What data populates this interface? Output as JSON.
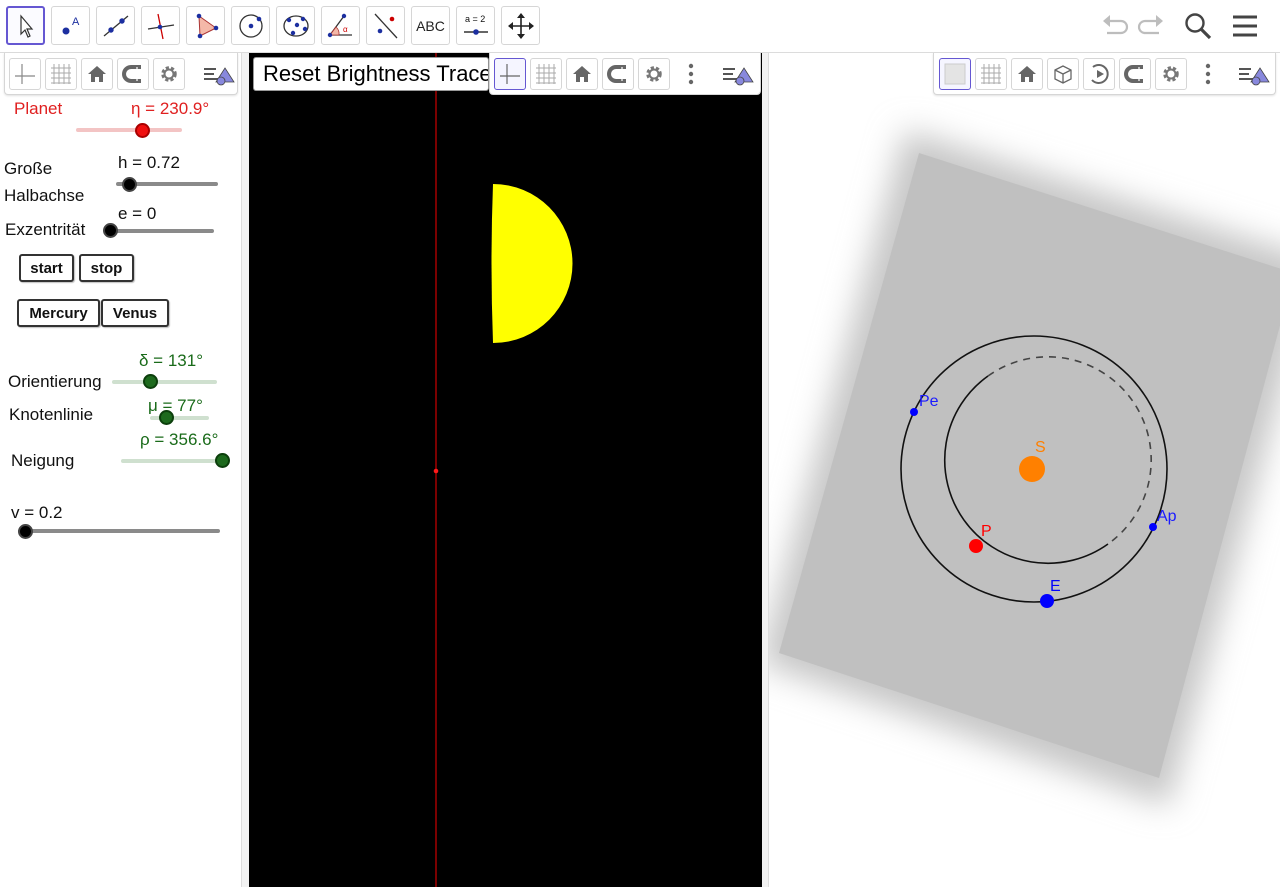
{
  "toolbar": {
    "tools": [
      {
        "name": "move-tool",
        "label": ""
      },
      {
        "name": "point-tool",
        "label": "A"
      },
      {
        "name": "line-tool",
        "label": ""
      },
      {
        "name": "perpendicular-line-tool",
        "label": ""
      },
      {
        "name": "polygon-tool",
        "label": ""
      },
      {
        "name": "circle-center-point-tool",
        "label": ""
      },
      {
        "name": "conic-five-points-tool",
        "label": ""
      },
      {
        "name": "angle-tool",
        "label": "α"
      },
      {
        "name": "reflect-tool",
        "label": ""
      },
      {
        "name": "text-tool",
        "label": "ABC"
      },
      {
        "name": "slider-tool",
        "label": "a = 2"
      },
      {
        "name": "move-graphics-view-tool",
        "label": ""
      }
    ]
  },
  "left_panel": {
    "planet_label": "Planet",
    "eta_value": "η = 230.9°",
    "h_label_1": "Große",
    "h_label_2": "Halbachse",
    "h_value": "h = 0.72",
    "e_label": "Exzentrität",
    "e_value": "e = 0",
    "start_label": "start",
    "stop_label": "stop",
    "mercury_label": "Mercury",
    "venus_label": "Venus",
    "delta_label": "Orientierung",
    "delta_value": "δ = 131°",
    "mu_label": "Knotenlinie",
    "mu_value": "μ = 77°",
    "rho_label": "Neigung",
    "rho_value": "ρ = 356.6°",
    "v_value": "v = 0.2"
  },
  "graphics_1": {
    "reset_button_label": "Reset Brightness Trace",
    "background": "#000000",
    "planet_color": "#ffff00",
    "axis_color": "#cc0000"
  },
  "graphics_3d": {
    "labels": {
      "sun": "S",
      "planet": "P",
      "earth": "E",
      "perihelion": "Pe",
      "aphelion": "Ap"
    },
    "colors": {
      "sun": "#ff8000",
      "planet": "#ff0000",
      "earth": "#0000ff"
    }
  },
  "colors": {
    "eta": "#e02020",
    "green": "#1a6b1a",
    "selection": "#6557d2"
  }
}
